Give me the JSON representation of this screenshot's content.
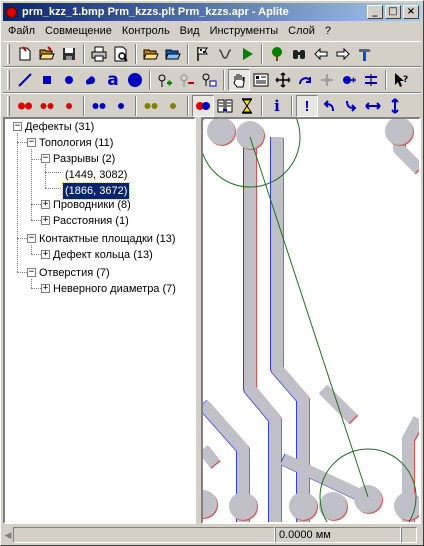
{
  "window": {
    "title": "prm_kzz_1.bmp   Prm_kzzs.plt   Prm_kzzs.apr - Aplite",
    "buttons": [
      "_",
      "□",
      "×"
    ]
  },
  "menu": [
    {
      "label": "Файл"
    },
    {
      "label": "Совмещение"
    },
    {
      "label": "Контроль"
    },
    {
      "label": "Вид"
    },
    {
      "label": "Инструменты"
    },
    {
      "label": "Слой"
    },
    {
      "label": "?"
    }
  ],
  "toolbar1": [
    {
      "name": "new-button",
      "icon": "new-file-icon"
    },
    {
      "name": "open-button",
      "icon": "open-folder-icon"
    },
    {
      "name": "save-button",
      "icon": "floppy-icon"
    },
    {
      "name": "print-button",
      "icon": "printer-icon"
    },
    {
      "name": "print-preview-button",
      "icon": "preview-icon"
    },
    {
      "name": "open-image-button",
      "icon": "open-folder-icon"
    },
    {
      "name": "open-plt-button",
      "icon": "open-folder-icon"
    },
    {
      "name": "flag-button",
      "icon": "flag-icon"
    },
    {
      "name": "trace-button",
      "icon": "trace-icon"
    },
    {
      "name": "run-button",
      "icon": "play-icon"
    },
    {
      "name": "tree-button",
      "icon": "tree-icon"
    },
    {
      "name": "find-button",
      "icon": "binoculars-icon"
    },
    {
      "name": "back-button",
      "icon": "arrow-left-icon"
    },
    {
      "name": "forward-button",
      "icon": "arrow-right-icon"
    },
    {
      "name": "tools-button",
      "icon": "hammer-icon"
    }
  ],
  "toolbar2": [
    {
      "name": "line-tool-button",
      "icon": "line-icon"
    },
    {
      "name": "rect-tool-button",
      "icon": "square-icon"
    },
    {
      "name": "circle-tool-button",
      "icon": "dot-icon"
    },
    {
      "name": "shape-tool-button",
      "icon": "shape-icon"
    },
    {
      "name": "text-tool-button",
      "icon": "letter-a-icon",
      "text": "a"
    },
    {
      "name": "pad-tool-button",
      "icon": "circle-icon"
    },
    {
      "name": "add-point-button",
      "icon": "add-point-icon"
    },
    {
      "name": "remove-point-button",
      "icon": "remove-point-icon"
    },
    {
      "name": "edit-point-button",
      "icon": "edit-point-icon"
    },
    {
      "name": "pan-button",
      "icon": "hand-icon"
    },
    {
      "name": "properties-button",
      "icon": "properties-icon"
    },
    {
      "name": "move-button",
      "icon": "move-icon"
    },
    {
      "name": "rotate-button",
      "icon": "rotate-icon"
    },
    {
      "name": "snap-button",
      "icon": "snap-icon"
    },
    {
      "name": "node-button",
      "icon": "node-icon"
    },
    {
      "name": "align-button",
      "icon": "align-icon"
    },
    {
      "name": "help-pointer-button",
      "icon": "help-pointer-icon"
    }
  ],
  "toolbar3": [
    {
      "name": "red-pair-large-button",
      "icon": "red-pair-icon"
    },
    {
      "name": "red-pair-small-button",
      "icon": "red-pair-small-icon"
    },
    {
      "name": "red-dot-button",
      "icon": "red-dot-icon"
    },
    {
      "name": "blue-pair-button",
      "icon": "blue-pair-icon"
    },
    {
      "name": "blue-dot-button",
      "icon": "blue-dot-icon"
    },
    {
      "name": "olive-pair-button",
      "icon": "olive-pair-icon"
    },
    {
      "name": "olive-dot-button",
      "icon": "olive-dot-icon"
    },
    {
      "name": "overlay-button",
      "icon": "overlay-icon"
    },
    {
      "name": "compare-button",
      "icon": "compare-icon"
    },
    {
      "name": "hourglass-button",
      "icon": "hourglass-icon"
    },
    {
      "name": "info-button",
      "icon": "info-icon",
      "text": "i"
    },
    {
      "name": "defect-button",
      "icon": "exclamation-icon",
      "text": "!"
    },
    {
      "name": "prev-defect-button",
      "icon": "curve-left-icon"
    },
    {
      "name": "next-defect-button",
      "icon": "curve-right-icon"
    },
    {
      "name": "horizontal-button",
      "icon": "arrows-horizontal-icon"
    },
    {
      "name": "vertical-button",
      "icon": "arrows-vertical-icon"
    }
  ],
  "tree": {
    "root": "Дефекты (31)",
    "topology": "Топология (11)",
    "breaks": "Разрывы (2)",
    "break1": "(1449, 3082)",
    "break2": "(1866, 3672)",
    "conductors": "Проводники (8)",
    "distances": "Расстояния (1)",
    "pads": "Контактные площадки (13)",
    "ring_defect": "Дефект кольца (13)",
    "holes": "Отверстия (7)",
    "wrong_diameter": "Неверного диаметра (7)"
  },
  "status": {
    "measure": "0.0000 мм"
  },
  "colors": {
    "trace": "#c0c0c8",
    "outline_red": "#e05050",
    "outline_blue": "#3040e0",
    "marker_green": "#207020",
    "selection": "#0a246a"
  }
}
